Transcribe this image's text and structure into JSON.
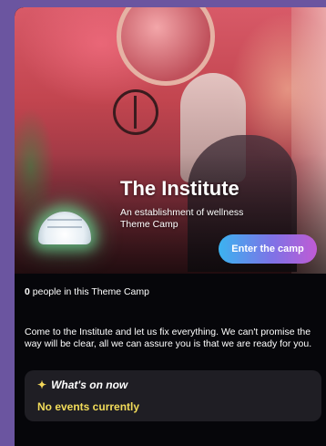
{
  "camp": {
    "title": "The Institute",
    "subtitle": "An establishment of wellness Theme Camp",
    "enter_label": "Enter the camp",
    "people_count": "0",
    "people_suffix": " people in this Theme Camp",
    "description": "Come to the Institute and let us fix everything. We can't promise the way will be clear, all we can assure you is that we are ready for you."
  },
  "events": {
    "header": "What's on now",
    "header_icon": "sparkle-icon",
    "empty_text": "No events currently"
  },
  "colors": {
    "background": "#6b55a0",
    "card": "#06060a",
    "button_gradient_start": "#3bb3f0",
    "button_gradient_end": "#c05bd4",
    "events_text": "#f2dc5a"
  }
}
